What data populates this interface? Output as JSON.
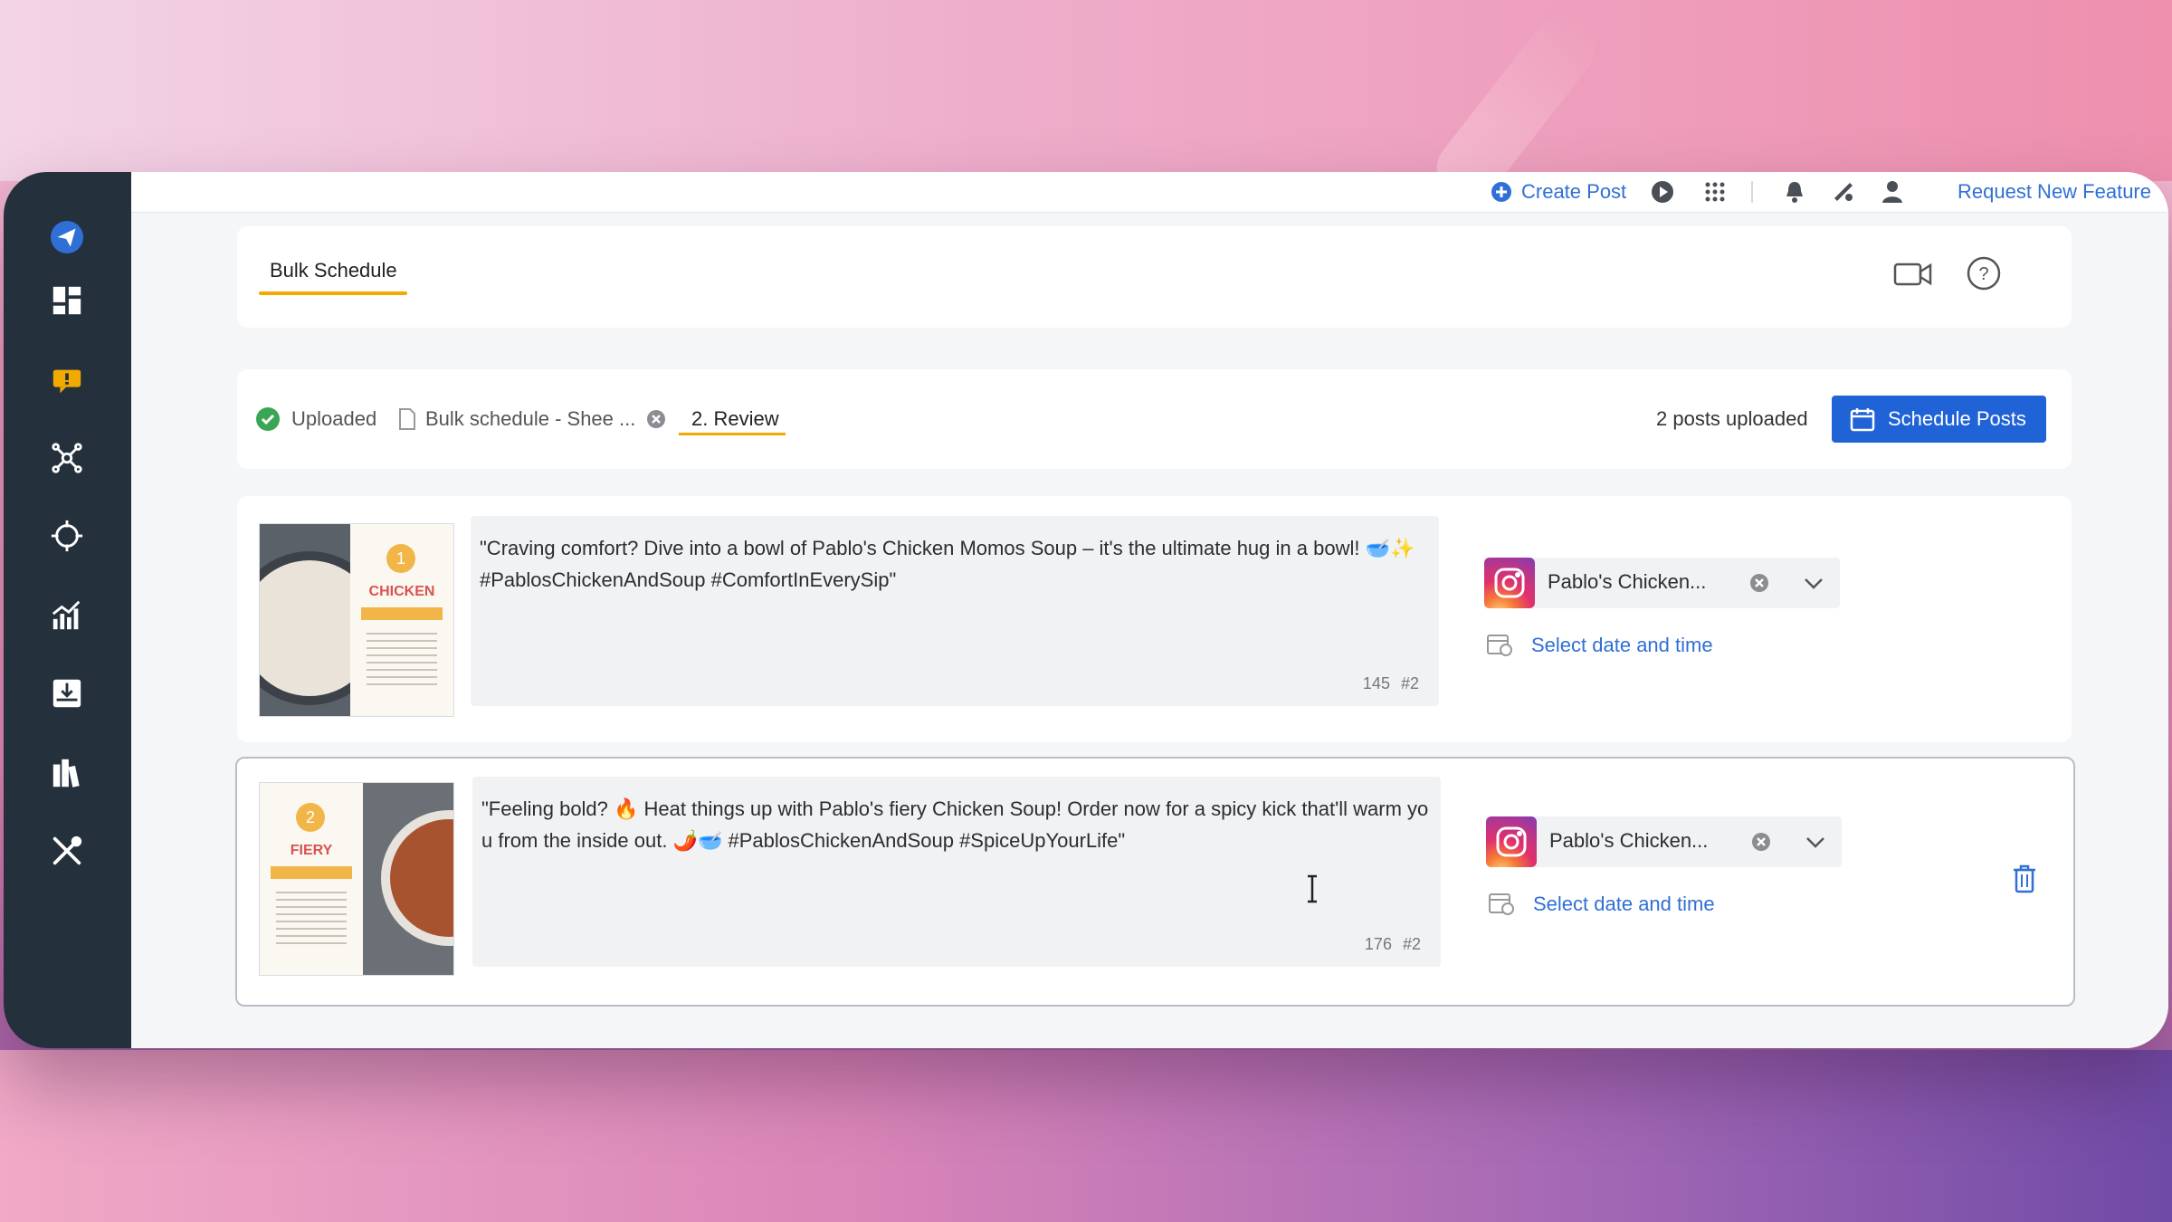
{
  "topbar": {
    "create_post": "Create Post",
    "request_feature": "Request New Feature"
  },
  "header": {
    "tab": "Bulk Schedule"
  },
  "steps": {
    "uploaded": "Uploaded",
    "file": "Bulk schedule - Shee ...",
    "review": "2. Review",
    "count_text": "2 posts uploaded",
    "schedule_button": "Schedule Posts"
  },
  "posts": [
    {
      "caption": "\"Craving comfort? Dive into a bowl of Pablo's Chicken Momos Soup – it's the ultimate hug in a bowl! 🥣✨ #PablosChickenAndSoup #ComfortInEverySip\"",
      "char_count": "145",
      "hashtag_count": "#2",
      "account": "Pablo's Chicken...",
      "date_link": "Select date and time",
      "thumb_number": "1",
      "thumb_title": "CHICKEN"
    },
    {
      "caption": "\"Feeling bold? 🔥 Heat things up with Pablo's fiery Chicken Soup! Order now for a spicy kick that'll warm you from the inside out. 🌶️🥣 #PablosChickenAndSoup #SpiceUpYourLife\"",
      "char_count": "176",
      "hashtag_count": "#2",
      "account": "Pablo's Chicken...",
      "date_link": "Select date and time",
      "thumb_number": "2",
      "thumb_title": "FIERY"
    }
  ],
  "colors": {
    "sidebar": "#25303d",
    "accent_blue": "#1f63d6",
    "link_blue": "#2f6fd6",
    "tab_underline": "#f2a900"
  }
}
